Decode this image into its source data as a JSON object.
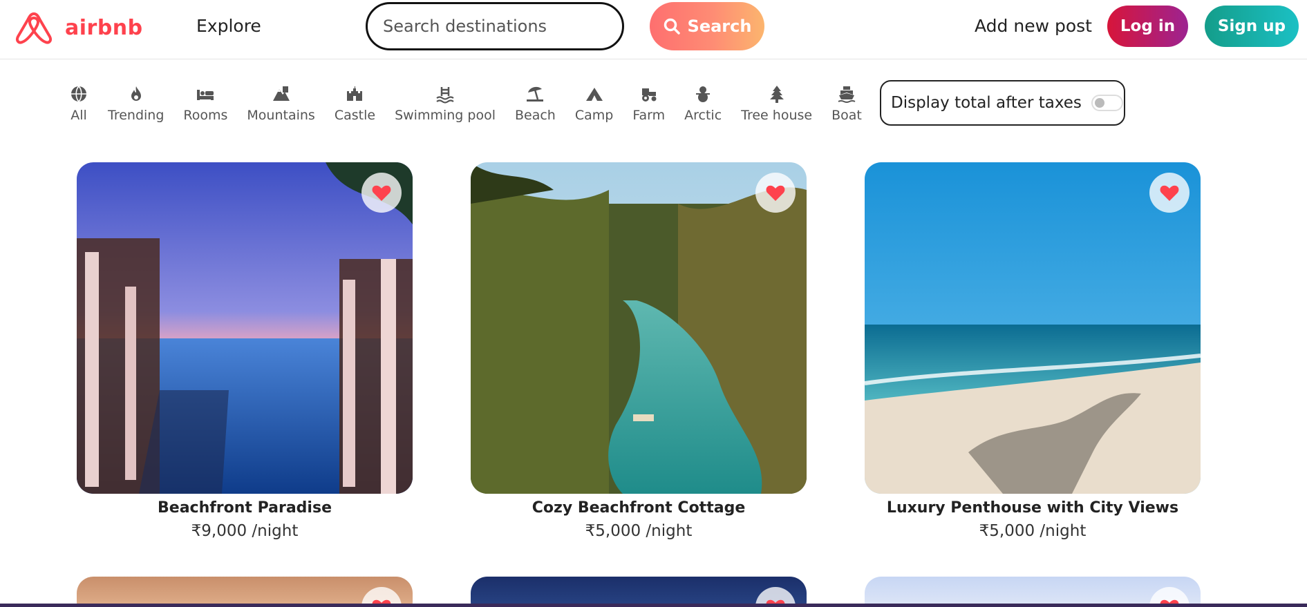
{
  "brand": {
    "name": "airbnb",
    "color": "#fe424d"
  },
  "nav": {
    "explore": "Explore",
    "search_placeholder": "Search destinations",
    "search_button": "Search",
    "add_post": "Add new post",
    "login": "Log in",
    "signup": "Sign up"
  },
  "filters": [
    {
      "label": "All",
      "icon": "globe-icon"
    },
    {
      "label": "Trending",
      "icon": "fire-icon"
    },
    {
      "label": "Rooms",
      "icon": "bed-icon"
    },
    {
      "label": "Mountains",
      "icon": "mountain-icon"
    },
    {
      "label": "Castle",
      "icon": "castle-icon"
    },
    {
      "label": "Swimming pool",
      "icon": "pool-icon"
    },
    {
      "label": "Beach",
      "icon": "umbrella-beach-icon"
    },
    {
      "label": "Camp",
      "icon": "campground-icon"
    },
    {
      "label": "Farm",
      "icon": "tractor-icon"
    },
    {
      "label": "Arctic",
      "icon": "snowman-icon"
    },
    {
      "label": "Tree house",
      "icon": "tree-icon"
    },
    {
      "label": "Boat",
      "icon": "ship-icon"
    }
  ],
  "tax_toggle": {
    "label": "Display total after taxes",
    "enabled": false
  },
  "listings": [
    {
      "title": "Beachfront Paradise",
      "price": "₹9,000 /night"
    },
    {
      "title": "Cozy Beachfront Cottage",
      "price": "₹5,000 /night"
    },
    {
      "title": "Luxury Penthouse with City Views",
      "price": "₹5,000 /night"
    }
  ],
  "colors": {
    "search_gradient": [
      "#fe6f6f",
      "#fcb56e"
    ],
    "login_gradient": [
      "#d7153a",
      "#9d2391"
    ],
    "signup_gradient": [
      "#149d8a",
      "#1bc0c4"
    ],
    "heart": "#fe424d"
  }
}
